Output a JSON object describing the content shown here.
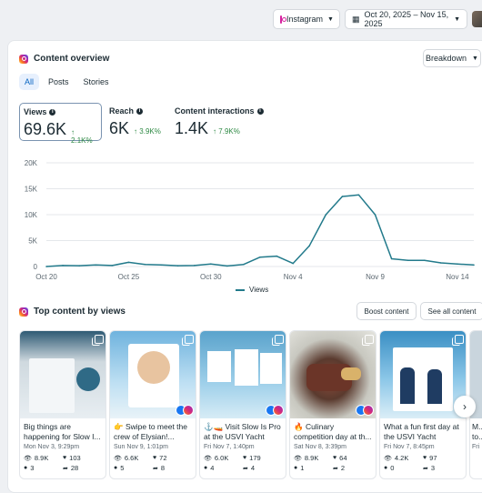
{
  "topbar": {
    "platform_label": "Instagram",
    "date_range": "Oct 20, 2025 – Nov 15, 2025"
  },
  "overview": {
    "title": "Content overview",
    "breakdown_label": "Breakdown",
    "tabs": [
      {
        "label": "All",
        "active": true
      },
      {
        "label": "Posts",
        "active": false
      },
      {
        "label": "Stories",
        "active": false
      }
    ],
    "metrics": [
      {
        "label": "Views",
        "value": "69.6K",
        "change": "2.1K%",
        "selected": true
      },
      {
        "label": "Reach",
        "value": "6K",
        "change": "3.9K%",
        "selected": false
      },
      {
        "label": "Content interactions",
        "value": "1.4K",
        "change": "7.9K%",
        "selected": false
      }
    ]
  },
  "chart_data": {
    "type": "line",
    "x": [
      "Oct 20",
      "Oct 21",
      "Oct 22",
      "Oct 23",
      "Oct 24",
      "Oct 25",
      "Oct 26",
      "Oct 27",
      "Oct 28",
      "Oct 29",
      "Oct 30",
      "Oct 31",
      "Nov 1",
      "Nov 2",
      "Nov 3",
      "Nov 4",
      "Nov 5",
      "Nov 6",
      "Nov 7",
      "Nov 8",
      "Nov 9",
      "Nov 10",
      "Nov 11",
      "Nov 12",
      "Nov 13",
      "Nov 14",
      "Nov 15"
    ],
    "x_tick_labels": [
      "Oct 20",
      "Oct 25",
      "Oct 30",
      "Nov 4",
      "Nov 9",
      "Nov 14"
    ],
    "series": [
      {
        "name": "Views",
        "color": "#227a8b",
        "values": [
          0,
          200,
          150,
          300,
          200,
          800,
          400,
          300,
          150,
          200,
          500,
          100,
          400,
          1800,
          2000,
          600,
          4000,
          10000,
          13500,
          13800,
          10000,
          1500,
          1200,
          1200,
          700,
          500,
          300
        ]
      }
    ],
    "y_ticks": [
      "0",
      "5K",
      "10K",
      "15K",
      "20K"
    ],
    "ylim": [
      0,
      20000
    ],
    "grid": true,
    "legend": "bottom-center"
  },
  "top_content": {
    "title": "Top content by views",
    "boost_label": "Boost content",
    "see_all_label": "See all content",
    "posts": [
      {
        "title": "Big things are happening for Slow I...",
        "date": "Mon Nov 3, 9:29pm",
        "views": "8.9K",
        "likes": "103",
        "comments": "3",
        "shares": "28"
      },
      {
        "title": "👉 Swipe to meet the crew of Elysian!...",
        "date": "Sun Nov 9, 1:01pm",
        "views": "6.6K",
        "likes": "72",
        "comments": "5",
        "shares": "8"
      },
      {
        "title": "⚓🚤 Visit Slow Is Pro at the USVI Yacht Show...",
        "date": "Fri Nov 7, 1:40pm",
        "views": "6.0K",
        "likes": "179",
        "comments": "4",
        "shares": "4"
      },
      {
        "title": "🔥 Culinary competition day at th...",
        "date": "Sat Nov 8, 3:39pm",
        "views": "8.9K",
        "likes": "64",
        "comments": "1",
        "shares": "2"
      },
      {
        "title": "What a fun first day at the USVI Yacht Show...",
        "date": "Fri Nov 7, 8:45pm",
        "views": "4.2K",
        "likes": "97",
        "comments": "0",
        "shares": "3"
      },
      {
        "title": "M... to...",
        "date": "Fri",
        "views": "",
        "likes": "",
        "comments": "",
        "shares": ""
      }
    ]
  }
}
